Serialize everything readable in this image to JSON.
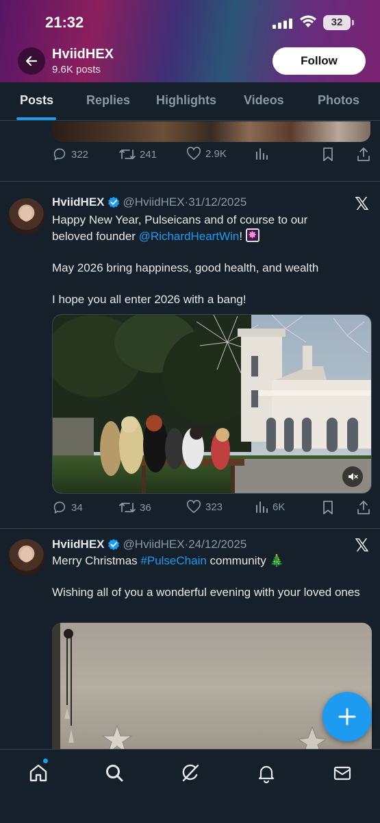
{
  "status_bar": {
    "time": "21:32",
    "battery": "32"
  },
  "profile": {
    "name": "HviidHEX",
    "posts_count": "9.6K posts",
    "follow_label": "Follow"
  },
  "tabs": [
    {
      "label": "Posts",
      "active": true
    },
    {
      "label": "Replies",
      "active": false
    },
    {
      "label": "Highlights",
      "active": false
    },
    {
      "label": "Videos",
      "active": false
    },
    {
      "label": "Photos",
      "active": false
    }
  ],
  "previous_post": {
    "replies": "322",
    "reposts": "241",
    "likes": "2.9K",
    "views": ""
  },
  "posts": [
    {
      "author": "HviidHEX",
      "handle": "@HviidHEX",
      "date": "31/12/2025",
      "text_line1": "Happy New Year, Pulseicans and of course to our",
      "text_line2_prefix": "beloved founder ",
      "mention": "@RichardHeartWin",
      "text_line2_suffix": "!",
      "text_para2": "May 2026 bring happiness, good health, and wealth",
      "text_para3": "I hope you all enter 2026 with a bang!",
      "replies": "34",
      "reposts": "36",
      "likes": "323",
      "views": "6K"
    },
    {
      "author": "HviidHEX",
      "handle": "@HviidHEX",
      "date": "24/12/2025",
      "text_line1_prefix": "Merry Christmas ",
      "hashtag": "#PulseChain",
      "text_line1_suffix": " community ",
      "tree_emoji": "🎄",
      "text_para2": "Wishing all of you a wonderful evening with your loved ones"
    }
  ],
  "icons": {
    "back": "arrow-left-icon",
    "verified": "verified-badge-icon",
    "x": "x-logo-icon",
    "reply": "reply-icon",
    "repost": "repost-icon",
    "like": "heart-icon",
    "views": "views-icon",
    "bookmark": "bookmark-icon",
    "share": "share-icon",
    "compose": "plus-icon",
    "home": "home-icon",
    "search": "search-icon",
    "grok": "grok-icon",
    "notifications": "bell-icon",
    "messages": "mail-icon"
  },
  "colors": {
    "accent": "#1d9bf0",
    "background": "#15202b",
    "secondary_text": "#8b98a5"
  }
}
